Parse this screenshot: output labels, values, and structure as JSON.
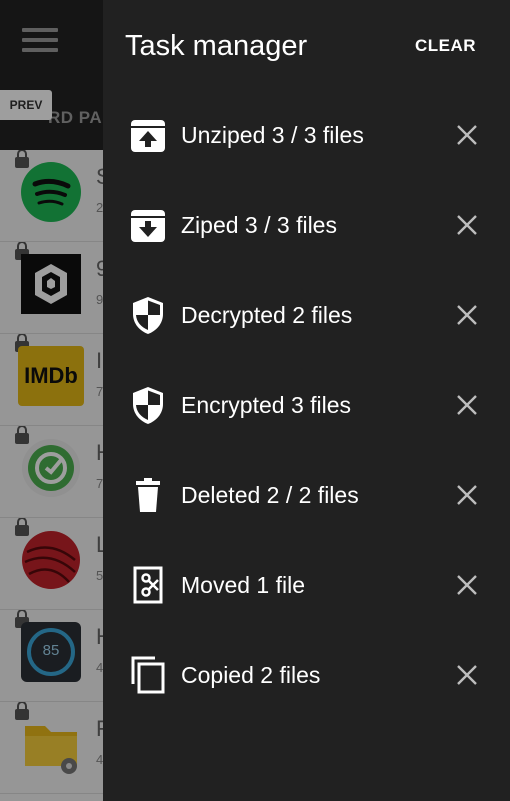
{
  "app": {
    "tab_text": "RD PA",
    "prev_label": "PREV",
    "list": [
      {
        "name": "spotify",
        "title": "S",
        "sub": "2"
      },
      {
        "name": "9gag",
        "title": "9",
        "sub": "9"
      },
      {
        "name": "imdb",
        "title": "I",
        "sub": "7",
        "logo_text": "IMDb"
      },
      {
        "name": "habit",
        "title": "H",
        "sub": "7"
      },
      {
        "name": "lastfm",
        "title": "L",
        "sub": "5"
      },
      {
        "name": "heart",
        "title": "H",
        "sub": "4",
        "reading": "85"
      },
      {
        "name": "folder",
        "title": "F",
        "sub": "4"
      }
    ]
  },
  "drawer": {
    "title": "Task manager",
    "clear_label": "CLEAR",
    "tasks": [
      {
        "icon": "archive-up-icon",
        "label": "Unziped 3 / 3 files"
      },
      {
        "icon": "archive-down-icon",
        "label": "Ziped 3 / 3 files"
      },
      {
        "icon": "shield-icon",
        "label": "Decrypted 2 files"
      },
      {
        "icon": "shield-icon",
        "label": "Encrypted 3 files"
      },
      {
        "icon": "trash-icon",
        "label": "Deleted 2 / 2 files"
      },
      {
        "icon": "cut-icon",
        "label": "Moved 1 file"
      },
      {
        "icon": "copy-icon",
        "label": "Copied 2 files"
      }
    ]
  }
}
